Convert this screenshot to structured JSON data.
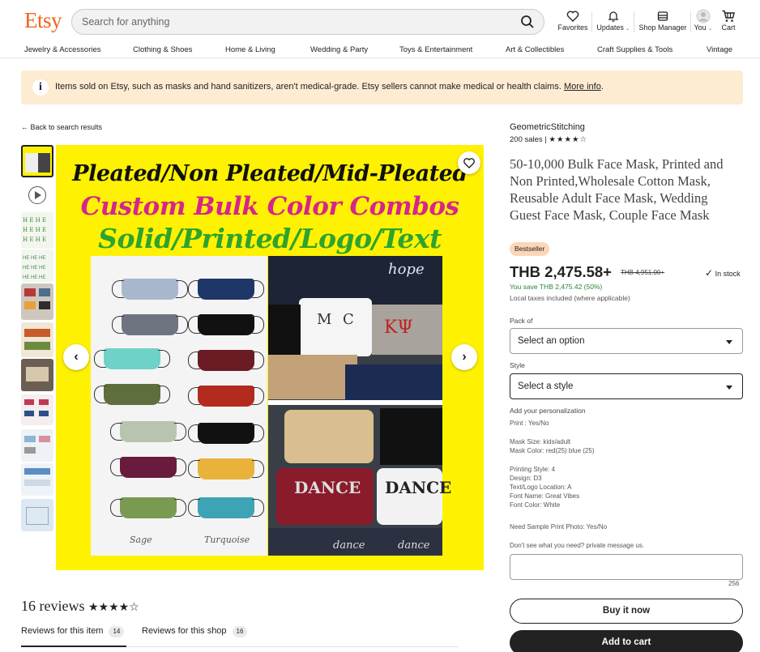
{
  "header": {
    "logo": "Etsy",
    "search_placeholder": "Search for anything",
    "nav": {
      "favorites": "Favorites",
      "updates": "Updates",
      "shop_manager": "Shop Manager",
      "you": "You",
      "cart": "Cart"
    }
  },
  "categories": [
    "Jewelry & Accessories",
    "Clothing & Shoes",
    "Home & Living",
    "Wedding & Party",
    "Toys & Entertainment",
    "Art & Collectibles",
    "Craft Supplies & Tools",
    "Vintage"
  ],
  "notice": {
    "text": "Items sold on Etsy, such as masks and hand sanitizers, aren't medical-grade. Etsy sellers cannot make medical or health claims.",
    "link": "More info"
  },
  "back_link": "← Back to search results",
  "image": {
    "line1": "Pleated/Non Pleated/Mid-Pleated",
    "line2": "Custom Bulk Color Combos",
    "line3": "Solid/Printed/Logo/Text",
    "label_sage": "Sage",
    "label_turquoise": "Turquoise",
    "print_text": [
      "hope",
      "M",
      "C",
      "ΚΨ",
      "DANCE",
      "DANCE",
      "dance",
      "dance"
    ]
  },
  "listing": {
    "shop_name": "GeometricStitching",
    "sales": "200 sales",
    "stars": "★★★★☆",
    "title": "50-10,000 Bulk Face Mask, Printed and Non Printed,Wholesale Cotton Mask, Reusable Adult Face Mask, Wedding Guest Face Mask, Couple Face Mask",
    "badge": "Bestseller",
    "price": "THB 2,475.58+",
    "old_price": "THB 4,951.00+",
    "in_stock": "In stock",
    "savings": "You save THB 2,475.42 (50%)",
    "tax_note": "Local taxes included (where applicable)",
    "pack_label": "Pack of",
    "pack_value": "Select an option",
    "style_label": "Style",
    "style_value": "Select a style",
    "personalization_label": "Add your personalization",
    "personalization_lines": [
      "Print : Yes/No",
      "",
      "Mask Size: kids/adult",
      "Mask Color: red(25) blue (25)",
      "",
      "Printing Style: 4",
      "Design: D3",
      "Text/Logo Location: A",
      "Font Name: Great Vibes",
      "Font Color: White",
      "",
      "Need Sample Print Photo: Yes/No",
      "",
      "Don't see what you need? private message us."
    ],
    "char_count": "256",
    "buy_now": "Buy it now",
    "add_to_cart": "Add to cart"
  },
  "reviews": {
    "heading": "16 reviews",
    "stars": "★★★★☆",
    "tab_item": "Reviews for this item",
    "tab_item_count": "14",
    "tab_shop": "Reviews for this shop",
    "tab_shop_count": "16"
  }
}
